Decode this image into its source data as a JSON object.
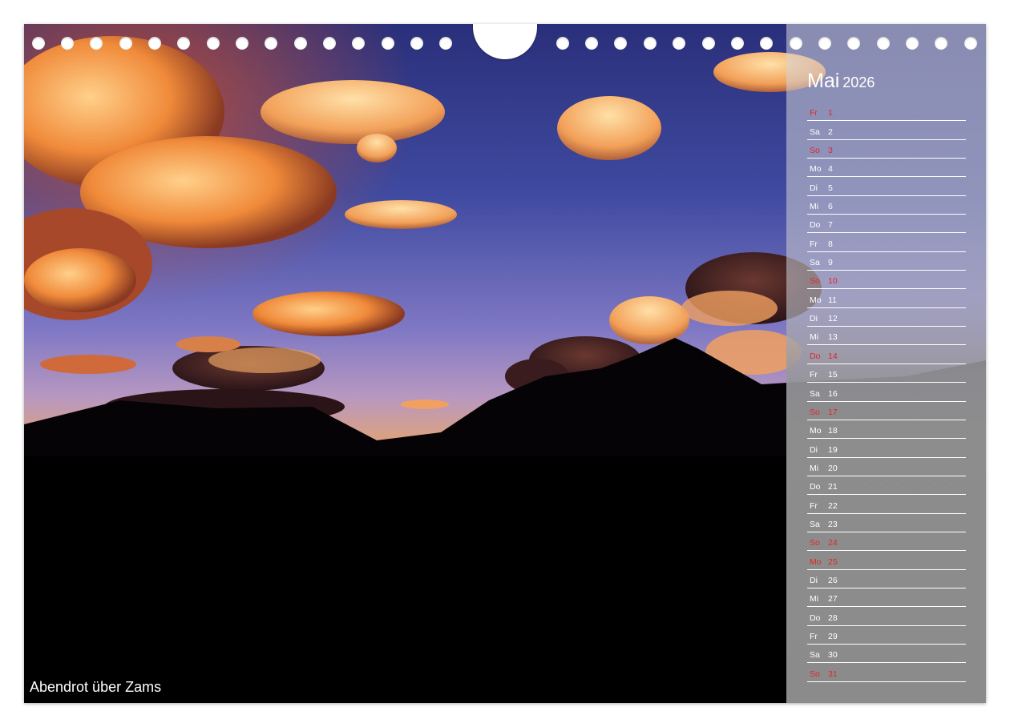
{
  "calendar": {
    "month": "Mai",
    "year": "2026",
    "days": [
      {
        "wd": "Fr",
        "d": "1",
        "red": true
      },
      {
        "wd": "Sa",
        "d": "2",
        "red": false
      },
      {
        "wd": "So",
        "d": "3",
        "red": true
      },
      {
        "wd": "Mo",
        "d": "4",
        "red": false
      },
      {
        "wd": "Di",
        "d": "5",
        "red": false
      },
      {
        "wd": "Mi",
        "d": "6",
        "red": false
      },
      {
        "wd": "Do",
        "d": "7",
        "red": false
      },
      {
        "wd": "Fr",
        "d": "8",
        "red": false
      },
      {
        "wd": "Sa",
        "d": "9",
        "red": false
      },
      {
        "wd": "So",
        "d": "10",
        "red": true
      },
      {
        "wd": "Mo",
        "d": "11",
        "red": false
      },
      {
        "wd": "Di",
        "d": "12",
        "red": false
      },
      {
        "wd": "Mi",
        "d": "13",
        "red": false
      },
      {
        "wd": "Do",
        "d": "14",
        "red": true
      },
      {
        "wd": "Fr",
        "d": "15",
        "red": false
      },
      {
        "wd": "Sa",
        "d": "16",
        "red": false
      },
      {
        "wd": "So",
        "d": "17",
        "red": true
      },
      {
        "wd": "Mo",
        "d": "18",
        "red": false
      },
      {
        "wd": "Di",
        "d": "19",
        "red": false
      },
      {
        "wd": "Mi",
        "d": "20",
        "red": false
      },
      {
        "wd": "Do",
        "d": "21",
        "red": false
      },
      {
        "wd": "Fr",
        "d": "22",
        "red": false
      },
      {
        "wd": "Sa",
        "d": "23",
        "red": false
      },
      {
        "wd": "So",
        "d": "24",
        "red": true
      },
      {
        "wd": "Mo",
        "d": "25",
        "red": true
      },
      {
        "wd": "Di",
        "d": "26",
        "red": false
      },
      {
        "wd": "Mi",
        "d": "27",
        "red": false
      },
      {
        "wd": "Do",
        "d": "28",
        "red": false
      },
      {
        "wd": "Fr",
        "d": "29",
        "red": false
      },
      {
        "wd": "Sa",
        "d": "30",
        "red": false
      },
      {
        "wd": "So",
        "d": "31",
        "red": true
      }
    ]
  },
  "photo": {
    "caption": "Abendrot über Zams"
  },
  "colors": {
    "holiday_red": "#e0262a",
    "sky_top": "#3a3f8c",
    "sky_mid": "#8a7fc8",
    "cloud_orange": "#f08a3a",
    "silhouette": "#050306"
  }
}
